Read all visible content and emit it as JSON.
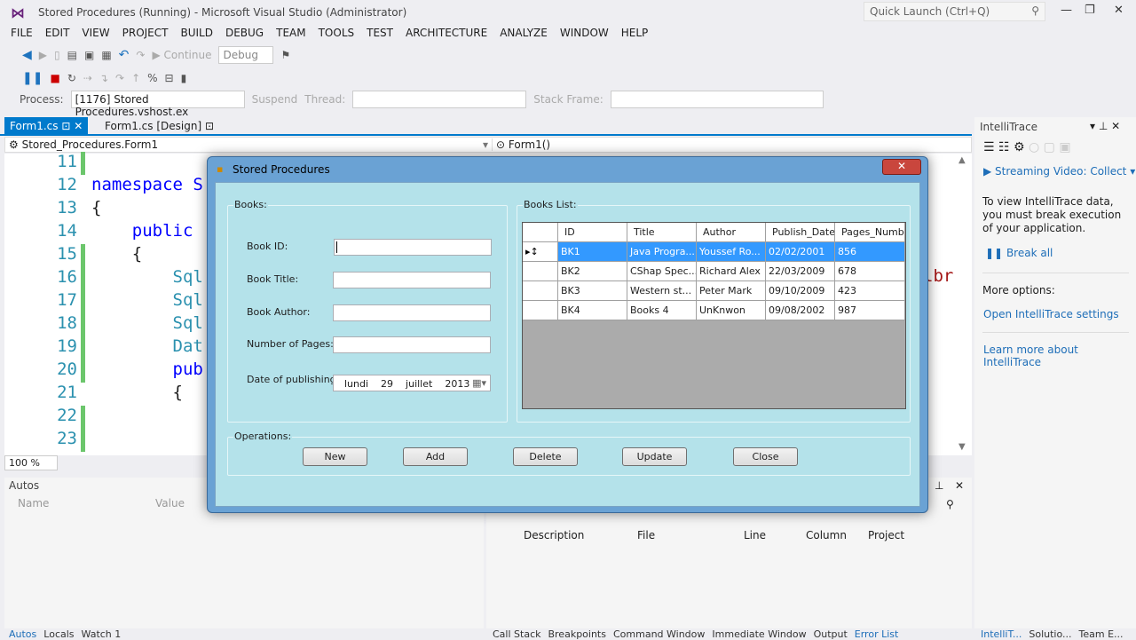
{
  "window": {
    "title": "Stored Procedures (Running) - Microsoft Visual Studio (Administrator)",
    "quick_launch": "Quick Launch (Ctrl+Q)"
  },
  "menu": [
    "FILE",
    "EDIT",
    "VIEW",
    "PROJECT",
    "BUILD",
    "DEBUG",
    "TEAM",
    "TOOLS",
    "TEST",
    "ARCHITECTURE",
    "ANALYZE",
    "WINDOW",
    "HELP"
  ],
  "toolbar": {
    "continue": "Continue",
    "config": "Debug",
    "process_label": "Process:",
    "process": "[1176] Stored Procedures.vshost.ex",
    "suspend": "Suspend",
    "thread_label": "Thread:",
    "stack_label": "Stack Frame:"
  },
  "tabs": [
    {
      "label": "Form1.cs",
      "active": true
    },
    {
      "label": "Form1.cs [Design]",
      "active": false
    }
  ],
  "nav": {
    "left": "Stored_Procedures.Form1",
    "right": "Form1()"
  },
  "editor": {
    "lines": [
      "11",
      "12",
      "13",
      "14",
      "15",
      "16",
      "17",
      "18",
      "19",
      "20",
      "21",
      "22",
      "23"
    ],
    "code": [
      "",
      "namespace S",
      "{",
      "    public",
      "    {",
      "        Sql",
      "        Sql",
      "        Sql",
      "        Dat",
      "        pub",
      "        {",
      "",
      ""
    ],
    "right_fragment": "lbr",
    "zoom": "100 %"
  },
  "autos": {
    "title": "Autos",
    "cols": [
      "Name",
      "Value"
    ]
  },
  "errors": {
    "cols": [
      "Description",
      "File",
      "Line",
      "Column",
      "Project"
    ]
  },
  "bottom_tabs_left": [
    "Autos",
    "Locals",
    "Watch 1"
  ],
  "bottom_tabs_mid": [
    "Call Stack",
    "Breakpoints",
    "Command Window",
    "Immediate Window",
    "Output",
    "Error List"
  ],
  "bottom_tabs_right": [
    "IntelliT...",
    "Solutio...",
    "Team E..."
  ],
  "intellitrace": {
    "title": "IntelliTrace",
    "streaming": "Streaming Video: Collect",
    "msg": "To view IntelliTrace data, you must break execution of your application.",
    "break_all": "Break all",
    "more": "More options:",
    "open_settings": "Open IntelliTrace settings",
    "learn": "Learn more about IntelliTrace"
  },
  "dialog": {
    "title": "Stored Procedures",
    "books_group": "Books:",
    "labels": {
      "id": "Book ID:",
      "title": "Book Title:",
      "author": "Book Author:",
      "pages": "Number of Pages:",
      "date": "Date of publishing"
    },
    "date": {
      "day": "lundi",
      "num": "29",
      "month": "juillet",
      "year": "2013"
    },
    "list_group": "Books List:",
    "columns": [
      "ID",
      "Title",
      "Author",
      "Publish_Date",
      "Pages_Number"
    ],
    "rows": [
      [
        "BK1",
        "Java Progra...",
        "Youssef Ro...",
        "02/02/2001",
        "856"
      ],
      [
        "BK2",
        "CShap Spec...",
        "Richard Alex",
        "22/03/2009",
        "678"
      ],
      [
        "BK3",
        "Western st...",
        "Peter Mark",
        "09/10/2009",
        "423"
      ],
      [
        "BK4",
        "Books 4",
        "UnKnwon",
        "09/08/2002",
        "987"
      ]
    ],
    "selected_row": 0,
    "ops_group": "Operations:",
    "buttons": [
      "New",
      "Add",
      "Delete",
      "Update",
      "Close"
    ]
  },
  "colors": {
    "accent": "#007acc",
    "selection": "#3399ff",
    "dialog_bg": "#b4e2ea"
  }
}
